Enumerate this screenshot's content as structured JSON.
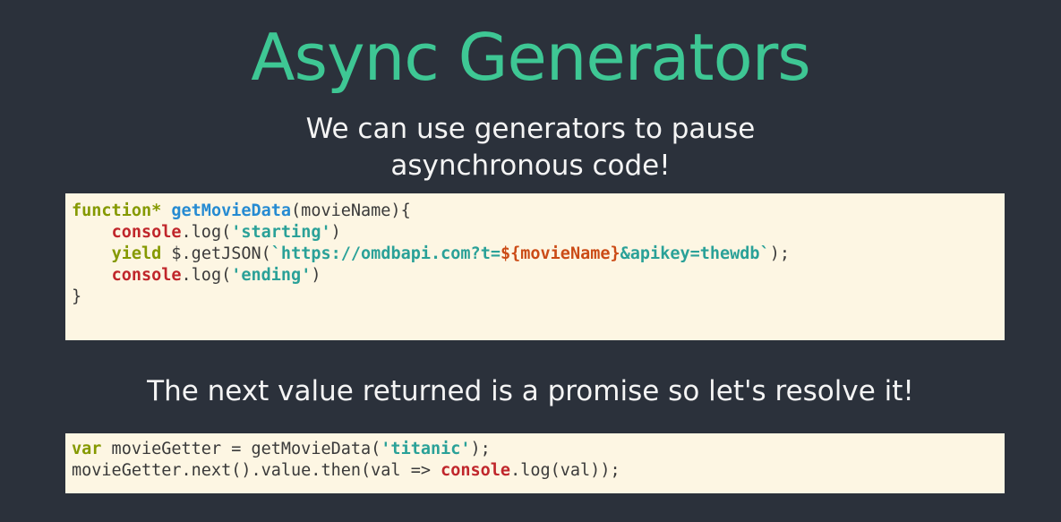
{
  "slide": {
    "title": "Async Generators",
    "subtitle_lines": [
      "We can use generators to pause",
      "asynchronous code!"
    ],
    "subtitle2": "The next value returned is a promise so let's resolve it!"
  },
  "code1": {
    "l1": {
      "kw": "function*",
      "sp": " ",
      "fn": "getMovieData",
      "rest": "(movieName){"
    },
    "l2": {
      "indent": "    ",
      "con": "console",
      "p1": ".log(",
      "str": "'starting'",
      "p2": ")"
    },
    "l3": {
      "indent": "    ",
      "kw": "yield",
      "p1": " $.getJSON(",
      "s1": "`https://omdbapi.com?t=",
      "i1": "${movieName}",
      "s2": "&apikey=thewdb`",
      "p2": ");"
    },
    "l4": {
      "indent": "    ",
      "con": "console",
      "p1": ".log(",
      "str": "'ending'",
      "p2": ")"
    },
    "l5": {
      "brace": "}"
    }
  },
  "code2": {
    "l1": {
      "kw": "var",
      "p1": " movieGetter = getMovieData(",
      "str": "'titanic'",
      "p2": ");"
    },
    "l2": {
      "p1": "movieGetter.next().value.then(val => ",
      "con": "console",
      "p2": ".log(val));"
    }
  },
  "colors": {
    "background": "#2b313b",
    "title": "#3ec794",
    "text": "#f4f4f4",
    "code_bg": "#fdf6e3",
    "keyword": "#859900",
    "function": "#268bd2",
    "string": "#2aa198",
    "console": "#c0262b",
    "interpolation": "#cb4b16"
  }
}
